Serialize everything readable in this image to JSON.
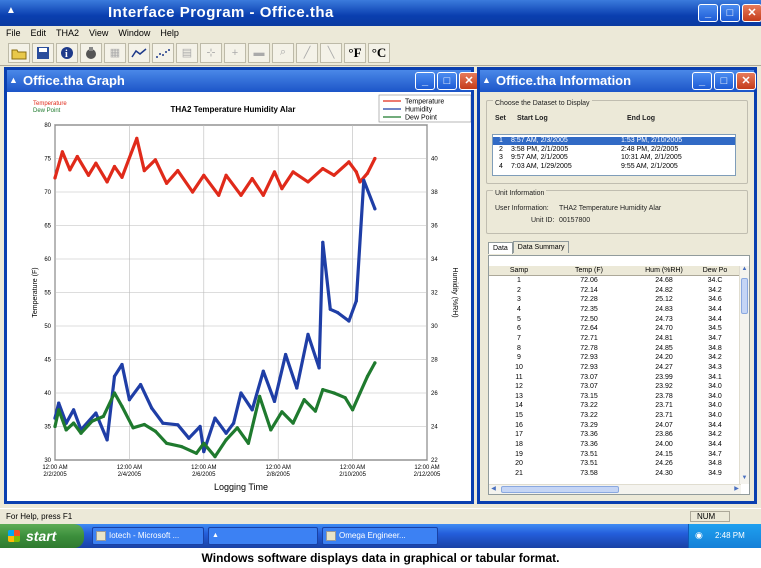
{
  "main_window": {
    "title": "Interface Program - Office.tha"
  },
  "menu": [
    "File",
    "Edit",
    "THA2",
    "View",
    "Window",
    "Help"
  ],
  "toolbar": {
    "fahrenheit": "°F",
    "celsius": "°C"
  },
  "graph_window": {
    "title": "Office.tha Graph"
  },
  "chart_data": {
    "type": "line",
    "title": "THA2 Temperature Humidity Alar",
    "xlabel": "Logging Time",
    "ylabel_left": "Temperature (F)",
    "ylabel_right": "Humidity (%RH)",
    "left_legend": [
      "Temperature",
      "Dew Point"
    ],
    "legend": [
      "Temperature",
      "Humidity",
      "Dew Point"
    ],
    "legend_placement": "top-right",
    "x_ticks": [
      {
        "t": "12:00 AM",
        "d": "2/2/2005"
      },
      {
        "t": "12:00 AM",
        "d": "2/4/2005"
      },
      {
        "t": "12:00 AM",
        "d": "2/6/2005"
      },
      {
        "t": "12:00 AM",
        "d": "2/8/2005"
      },
      {
        "t": "12:00 AM",
        "d": "2/10/2005"
      },
      {
        "t": "12:00 AM",
        "d": "2/12/2005"
      }
    ],
    "xlim": [
      0,
      10
    ],
    "y_left_ticks": [
      30,
      35,
      40,
      45,
      50,
      55,
      60,
      65,
      70,
      75,
      80
    ],
    "ylim_left": [
      30,
      80
    ],
    "y_right_ticks": [
      22,
      24,
      26,
      28,
      30,
      32,
      34,
      36,
      38,
      40
    ],
    "ylim_right": [
      22,
      42
    ],
    "grid": true,
    "series": [
      {
        "name": "Temperature",
        "axis": "left",
        "color": "#e02a1a",
        "x": [
          0.0,
          0.2,
          0.4,
          0.6,
          0.9,
          1.1,
          1.4,
          1.6,
          1.8,
          2.2,
          2.4,
          2.7,
          3.0,
          3.3,
          3.7,
          4.0,
          4.4,
          4.6,
          5.0,
          5.3,
          5.6,
          5.9,
          6.1,
          6.4,
          6.8,
          7.2,
          7.5,
          7.9,
          8.1,
          8.2,
          8.4,
          8.6
        ],
        "y": [
          72.1,
          76,
          73.3,
          75.3,
          72.5,
          74.3,
          71.5,
          73.8,
          72.2,
          78,
          73.2,
          74.8,
          71.3,
          73.2,
          70,
          72.5,
          69.5,
          72.5,
          69.5,
          72,
          69.5,
          73,
          70.5,
          73,
          71.5,
          73.5,
          72.5,
          74.5,
          73,
          71.5,
          72.8,
          75
        ]
      },
      {
        "name": "Humidity",
        "axis": "right",
        "color": "#1f3ea6",
        "x": [
          0.0,
          0.1,
          0.3,
          0.5,
          0.7,
          1.1,
          1.4,
          1.6,
          1.8,
          2.0,
          2.3,
          2.6,
          2.9,
          3.3,
          3.6,
          3.9,
          4.0,
          4.3,
          4.6,
          4.8,
          5.0,
          5.3,
          5.6,
          5.9,
          6.2,
          6.5,
          6.8,
          7.1,
          7.2,
          7.4,
          7.6,
          7.9,
          8.1,
          8.3,
          8.6
        ],
        "y": [
          24.5,
          25.4,
          24.2,
          25,
          23.8,
          24.8,
          23.2,
          27,
          27.7,
          25.6,
          26.5,
          25.1,
          24.2,
          24.1,
          23.3,
          24,
          22.5,
          24.5,
          23.6,
          24.2,
          26,
          25,
          27.3,
          25.5,
          28.3,
          26.3,
          29.5,
          27.5,
          35,
          31,
          30.8,
          30.3,
          31.5,
          38.7,
          37
        ]
      },
      {
        "name": "Dew Point",
        "axis": "left",
        "color": "#1f7a2e",
        "x": [
          0.0,
          0.1,
          0.3,
          0.5,
          0.7,
          1.0,
          1.3,
          1.6,
          1.8,
          2.1,
          2.4,
          2.7,
          3.0,
          3.4,
          3.8,
          4.0,
          4.3,
          4.6,
          4.9,
          5.2,
          5.5,
          5.8,
          6.1,
          6.4,
          6.7,
          7.0,
          7.2,
          7.5,
          7.8,
          8.0,
          8.2,
          8.4,
          8.6
        ],
        "y": [
          35,
          37.5,
          34.5,
          35.5,
          34,
          35.8,
          36.5,
          40,
          38,
          34.8,
          35.3,
          34.3,
          32.5,
          32,
          31,
          32.5,
          30.5,
          33,
          34.8,
          32.5,
          39.5,
          34.5,
          37.2,
          35.5,
          39,
          37.3,
          40.5,
          40,
          39.3,
          37.5,
          40,
          42.5,
          44.5
        ]
      }
    ]
  },
  "info_window": {
    "title": "Office.tha Information",
    "choose_label": "Choose the Dataset to Display",
    "headers": {
      "set": "Set",
      "start": "Start Log",
      "end": "End Log"
    },
    "datasets": [
      {
        "set": "1",
        "start": "8:57 AM, 2/3/2005",
        "end": "1:53 PM, 2/10/2005"
      },
      {
        "set": "2",
        "start": "3:58 PM, 2/1/2005",
        "end": "2:48 PM, 2/2/2005"
      },
      {
        "set": "3",
        "start": "9:57 AM, 2/1/2005",
        "end": "10:31 AM, 2/1/2005"
      },
      {
        "set": "4",
        "start": "7:03 AM, 1/29/2005",
        "end": "9:55 AM, 2/1/2005"
      }
    ],
    "unit_info_label": "Unit Information",
    "user_info_label": "User Information:",
    "user_info_value": "THA2 Temperature Humidity Alar",
    "unit_id_label": "Unit ID:",
    "unit_id_value": "00157800",
    "tabs": [
      "Data",
      "Data Summary"
    ],
    "table": {
      "columns": [
        "Samp",
        "Temp (F)",
        "Hum (%RH)",
        "Dew Po"
      ],
      "rows": [
        [
          "1",
          "72.06",
          "24.68",
          "34.C"
        ],
        [
          "2",
          "72.14",
          "24.82",
          "34.2"
        ],
        [
          "3",
          "72.28",
          "25.12",
          "34.6"
        ],
        [
          "4",
          "72.35",
          "24.83",
          "34.4"
        ],
        [
          "5",
          "72.50",
          "24.73",
          "34.4"
        ],
        [
          "6",
          "72.64",
          "24.70",
          "34.5"
        ],
        [
          "7",
          "72.71",
          "24.81",
          "34.7"
        ],
        [
          "8",
          "72.78",
          "24.85",
          "34.8"
        ],
        [
          "9",
          "72.93",
          "24.20",
          "34.2"
        ],
        [
          "10",
          "72.93",
          "24.27",
          "34.3"
        ],
        [
          "11",
          "73.07",
          "23.99",
          "34.1"
        ],
        [
          "12",
          "73.07",
          "23.92",
          "34.0"
        ],
        [
          "13",
          "73.15",
          "23.78",
          "34.0"
        ],
        [
          "14",
          "73.22",
          "23.71",
          "34.0"
        ],
        [
          "15",
          "73.22",
          "23.71",
          "34.0"
        ],
        [
          "16",
          "73.29",
          "24.07",
          "34.4"
        ],
        [
          "17",
          "73.36",
          "23.86",
          "34.2"
        ],
        [
          "18",
          "73.36",
          "24.00",
          "34.4"
        ],
        [
          "19",
          "73.51",
          "24.15",
          "34.7"
        ],
        [
          "20",
          "73.51",
          "24.26",
          "34.8"
        ],
        [
          "21",
          "73.58",
          "24.30",
          "34.9"
        ]
      ]
    }
  },
  "status": {
    "help": "For Help, press F1",
    "num": "NUM"
  },
  "taskbar": {
    "start": "start",
    "tasks": [
      "Iotech - Microsoft ...",
      "",
      "Omega Engineer..."
    ],
    "clock": "2:48 PM"
  },
  "caption": "Windows software displays data in graphical or tabular format."
}
